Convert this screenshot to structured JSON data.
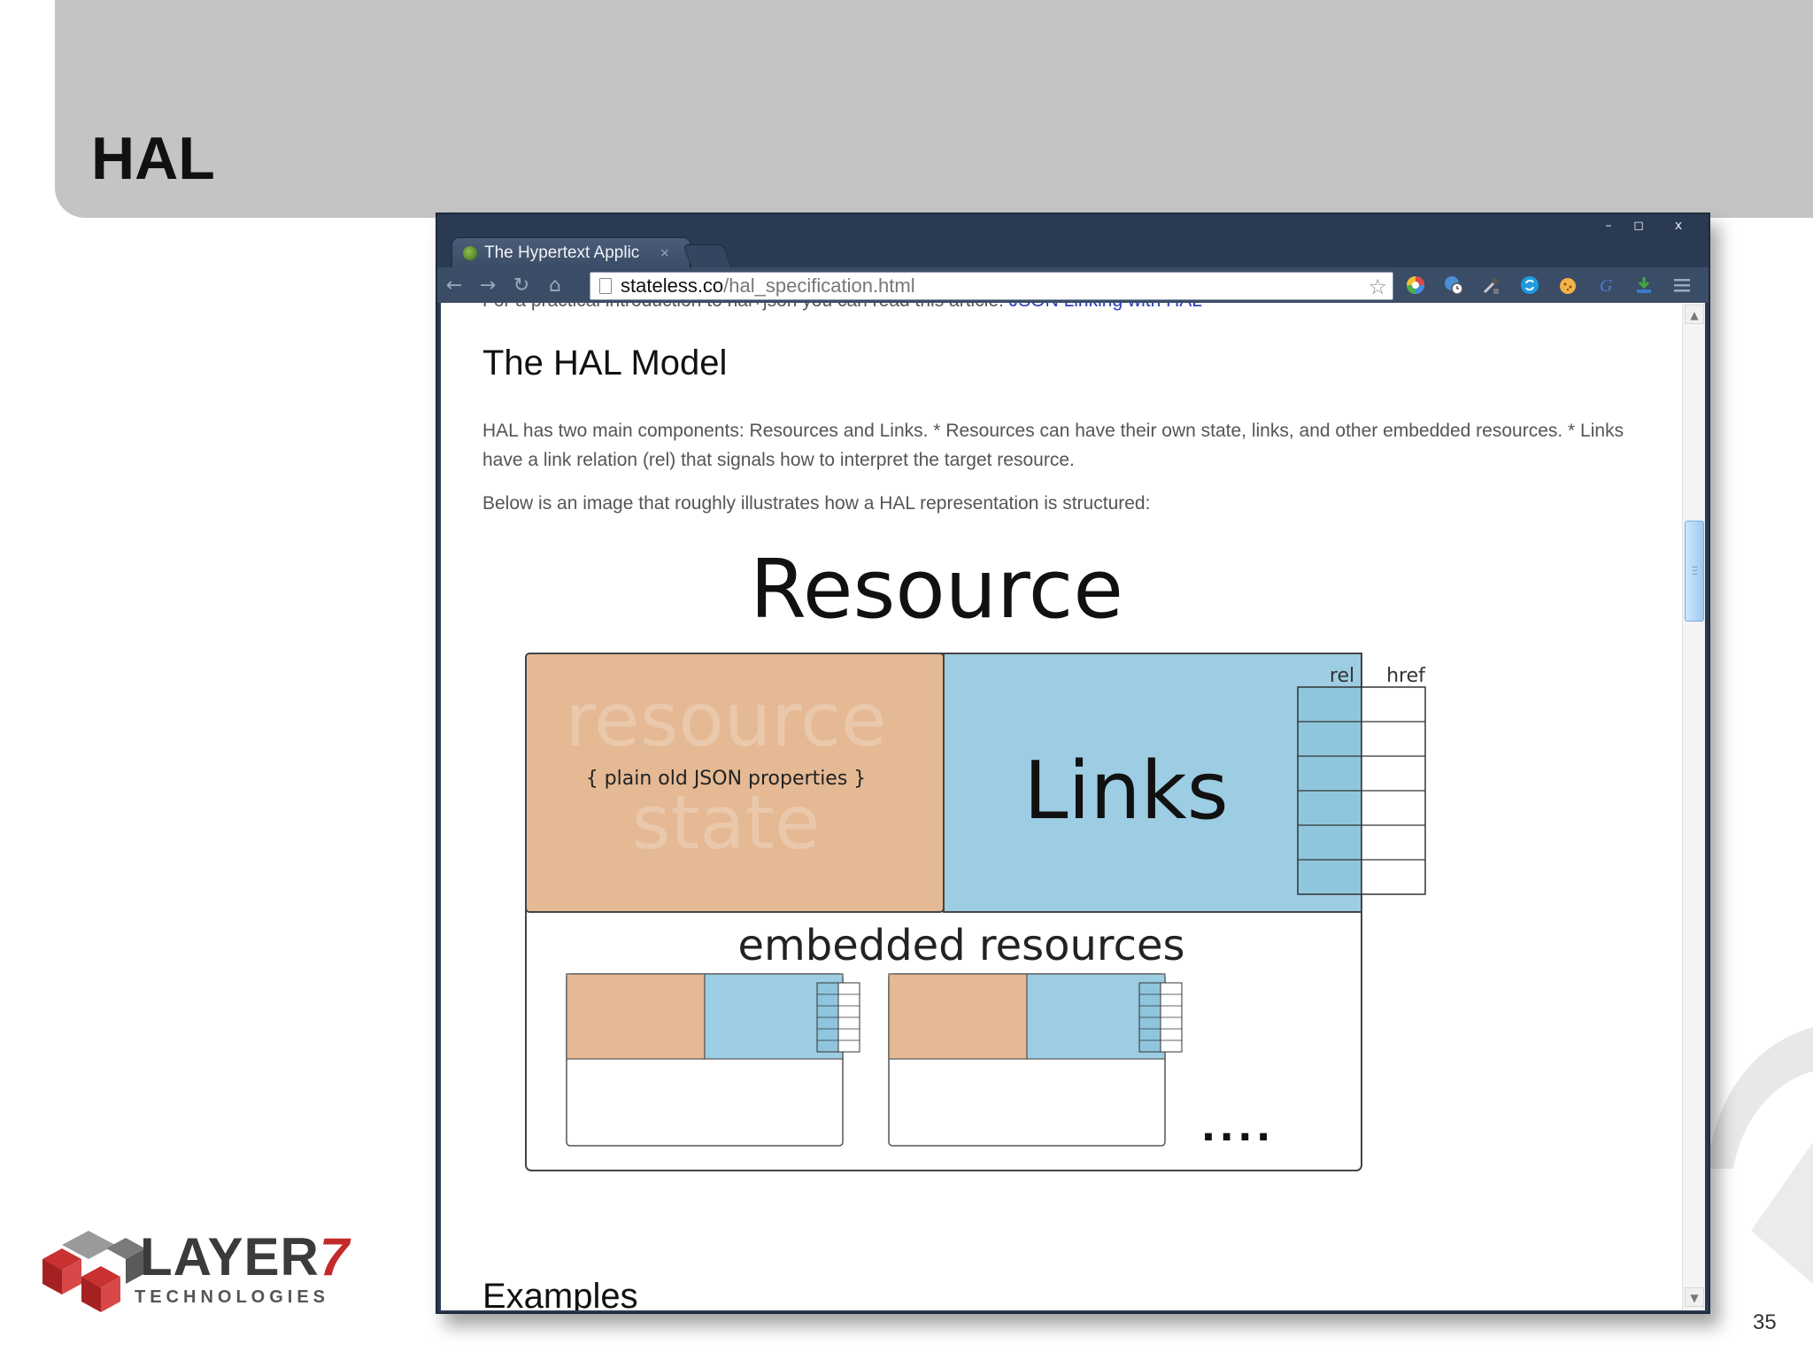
{
  "slide": {
    "title": "HAL",
    "page_number": "35",
    "logo": {
      "name": "LAYER",
      "numeral": "7",
      "tagline": "TECHNOLOGIES"
    }
  },
  "browser": {
    "tab_title": "The Hypertext Applic",
    "tab_close": "×",
    "window_controls": [
      "–",
      "◻",
      "x"
    ],
    "url_host": "stateless.co",
    "url_path": "/hal_specification.html",
    "nav": [
      "←",
      "→",
      "↻",
      "⌂"
    ]
  },
  "content": {
    "cut_text_plain": "For a practical introduction to hal+json you can read this article: ",
    "cut_text_link": "JSON Linking with HAL",
    "heading": "The HAL Model",
    "paragraph1": "HAL has two main components: Resources and Links. * Resources can have their own state, links, and other embedded resources. * Links have a link relation (rel) that signals how to interpret the target resource.",
    "paragraph2": "Below is an image that roughly illustrates how a HAL representation is structured:",
    "next_heading": "Examples"
  },
  "diagram": {
    "title": "Resource",
    "state_word1": "resource",
    "state_word2": "state",
    "state_caption": "{ plain old JSON properties }",
    "links_label": "Links",
    "rel_label": "rel",
    "href_label": "href",
    "embedded_label": "embedded resources",
    "ellipsis": "....",
    "colors": {
      "state": "#e4b994",
      "links": "#9ccde3",
      "border": "#444444"
    }
  }
}
